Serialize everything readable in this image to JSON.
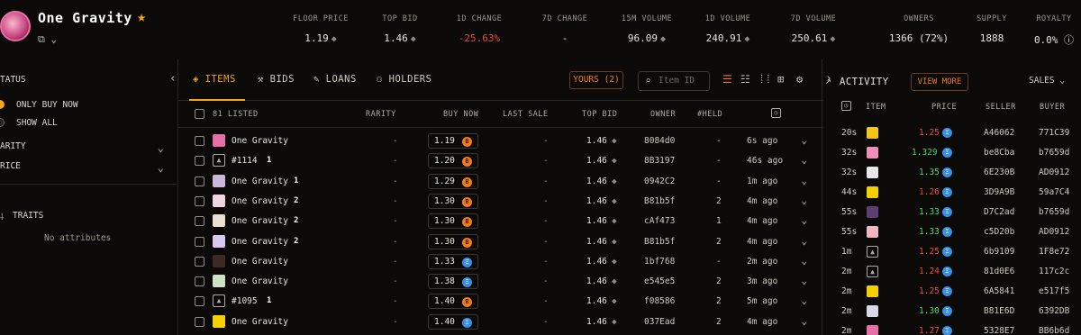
{
  "collection": {
    "name": "One Gravity",
    "star": "★"
  },
  "stats": [
    {
      "label": "FLOOR PRICE",
      "value": "1.19",
      "icon": "eth-icon"
    },
    {
      "label": "TOP BID",
      "value": "1.46",
      "icon": "eth-icon"
    },
    {
      "label": "1D CHANGE",
      "value": "-25.63%",
      "color": "#ec4a3c"
    },
    {
      "label": "7D CHANGE",
      "value": "-"
    },
    {
      "label": "15M VOLUME",
      "value": "96.09",
      "icon": "eth-icon"
    },
    {
      "label": "1D VOLUME",
      "value": "240.91",
      "icon": "eth-icon"
    },
    {
      "label": "7D VOLUME",
      "value": "250.61",
      "icon": "eth-icon"
    },
    {
      "label": "OWNERS",
      "value": "1366 (72%)"
    },
    {
      "label": "SUPPLY",
      "value": "1888"
    },
    {
      "label": "ROYALTY",
      "value": "0.0%"
    }
  ],
  "sidebar": {
    "status_label": "TATUS",
    "only_buy_now": "ONLY BUY NOW",
    "show_all": "SHOW ALL",
    "rarity": "ARITY",
    "price": "RICE",
    "traits": "TRAITS",
    "no_attributes": "No attributes"
  },
  "tabs": {
    "items": "ITEMS",
    "bids": "BIDS",
    "loans": "LOANS",
    "holders": "HOLDERS"
  },
  "toolbar": {
    "yours": "YOURS (2)",
    "search_placeholder": "Item ID"
  },
  "table": {
    "headers": {
      "listed": "81 LISTED",
      "rarity": "RARITY",
      "buy_now": "BUY NOW",
      "last_sale": "LAST SALE",
      "top_bid": "TOP BID",
      "owner": "OWNER",
      "held": "#HELD"
    },
    "rows": [
      {
        "name": "One Gravity",
        "thumb": "#e76fa8",
        "rarity": "-",
        "buy": "1.19",
        "coin": "o",
        "last": "-",
        "top": "1.46",
        "owner": "8084d0",
        "held": "-",
        "time": "6s ago"
      },
      {
        "name": "#1114",
        "thumb": "img",
        "badge": "1",
        "rarity": "-",
        "buy": "1.20",
        "coin": "o",
        "last": "-",
        "top": "1.46",
        "owner": "8B3197",
        "held": "-",
        "time": "46s ago"
      },
      {
        "name": "One Gravity",
        "thumb": "#c9b7d8",
        "badge": "1",
        "rarity": "-",
        "buy": "1.29",
        "coin": "o",
        "last": "-",
        "top": "1.46",
        "owner": "0942C2",
        "held": "-",
        "time": "1m ago"
      },
      {
        "name": "One Gravity",
        "thumb": "#f0d5e0",
        "badge": "2",
        "rarity": "-",
        "buy": "1.30",
        "coin": "o",
        "last": "-",
        "top": "1.46",
        "owner": "B81b5f",
        "held": "2",
        "time": "4m ago"
      },
      {
        "name": "One Gravity",
        "thumb": "#e8e0d0",
        "badge": "2",
        "rarity": "-",
        "buy": "1.30",
        "coin": "o",
        "last": "-",
        "top": "1.46",
        "owner": "cAf473",
        "held": "1",
        "time": "4m ago"
      },
      {
        "name": "One Gravity",
        "thumb": "#d7c8f0",
        "badge": "2",
        "rarity": "-",
        "buy": "1.30",
        "coin": "o",
        "last": "-",
        "top": "1.46",
        "owner": "B81b5f",
        "held": "2",
        "time": "4m ago"
      },
      {
        "name": "One Gravity",
        "thumb": "#3b2b20",
        "rarity": "-",
        "buy": "1.33",
        "coin": "b",
        "last": "-",
        "top": "1.46",
        "owner": "1bf768",
        "held": "-",
        "time": "2m ago"
      },
      {
        "name": "One Gravity",
        "thumb": "#cfe0c8",
        "rarity": "-",
        "buy": "1.38",
        "coin": "b",
        "last": "-",
        "top": "1.46",
        "owner": "e545e5",
        "held": "2",
        "time": "3m ago"
      },
      {
        "name": "#1095",
        "thumb": "img",
        "badge": "1",
        "rarity": "-",
        "buy": "1.40",
        "coin": "o",
        "last": "-",
        "top": "1.46",
        "owner": "f08586",
        "held": "2",
        "time": "5m ago"
      },
      {
        "name": "One Gravity",
        "thumb": "#f5d000",
        "rarity": "-",
        "buy": "1.40",
        "coin": "b",
        "last": "-",
        "top": "1.46",
        "owner": "037Ead",
        "held": "2",
        "time": "4m ago"
      }
    ]
  },
  "activity": {
    "title": "ACTIVITY",
    "view_more": "VIEW MORE",
    "filter": "SALES",
    "headers": {
      "item": "ITEM",
      "price": "PRICE",
      "seller": "SELLER",
      "buyer": "BUYER"
    },
    "rows": [
      {
        "time": "20s",
        "thumb": "#f5c518",
        "price": "1.25",
        "color": "red",
        "seller": "A46062",
        "buyer": "771C39"
      },
      {
        "time": "32s",
        "thumb": "#ef8fb8",
        "price": "1.329",
        "color": "green",
        "seller": "be8Cba",
        "buyer": "b7659d"
      },
      {
        "time": "32s",
        "thumb": "#e8e8e8",
        "price": "1.35",
        "color": "green",
        "seller": "6E230B",
        "buyer": "AD0912"
      },
      {
        "time": "44s",
        "thumb": "#f5d000",
        "price": "1.26",
        "color": "red",
        "seller": "3D9A9B",
        "buyer": "59a7C4"
      },
      {
        "time": "55s",
        "thumb": "#5a3f70",
        "price": "1.33",
        "color": "green",
        "seller": "D7C2ad",
        "buyer": "b7659d"
      },
      {
        "time": "55s",
        "thumb": "#f2b6c0",
        "price": "1.33",
        "color": "green",
        "seller": "c5D20b",
        "buyer": "AD0912"
      },
      {
        "time": "1m",
        "thumb": "img",
        "price": "1.25",
        "color": "red",
        "seller": "6b9109",
        "buyer": "1F8e72"
      },
      {
        "time": "2m",
        "thumb": "img",
        "price": "1.24",
        "color": "red",
        "seller": "81d0E6",
        "buyer": "117c2c"
      },
      {
        "time": "2m",
        "thumb": "#f5d000",
        "price": "1.25",
        "color": "red",
        "seller": "6A5841",
        "buyer": "e517f5"
      },
      {
        "time": "2m",
        "thumb": "#d8d8e8",
        "price": "1.30",
        "color": "green",
        "seller": "B81E6D",
        "buyer": "6392DB"
      },
      {
        "time": "2m",
        "thumb": "#e76fa8",
        "price": "1.27",
        "color": "red",
        "seller": "5328E7",
        "buyer": "BB6b6d"
      }
    ]
  }
}
